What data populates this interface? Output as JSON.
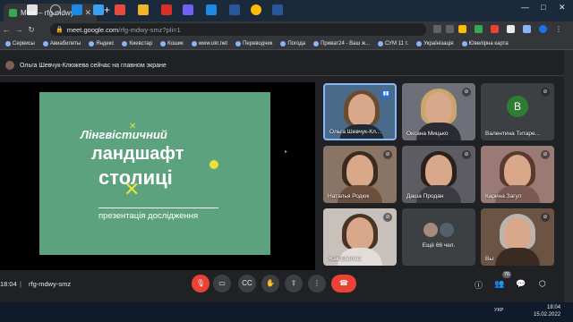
{
  "browser": {
    "tab_title": "Meet – rfg-mdwy-smz",
    "url_host": "meet.google.com",
    "url_path": "/rfg-mdwy-smz?pli=1",
    "bookmarks": [
      "Сервисы",
      "Авиабилеты",
      "Яндекс",
      "Киевстар",
      "Кошик",
      "www.ukr.net",
      "Переводчик",
      "Погода",
      "Приват24 - Ваш ж...",
      "СУМ 11 т.",
      "Українізація",
      "Ювелірна карта"
    ]
  },
  "meet": {
    "banner": "Ольга Шевчук-Клюжева сейчас на главном экране",
    "slide": {
      "line1": "Лінгвістичний",
      "line2": "ландшафт",
      "line3": "столиці",
      "subtitle": "презентація дослідження"
    },
    "tiles": [
      {
        "name": "Ольга Шевчук-Кл...",
        "speaking": true
      },
      {
        "name": "Оксана Мицько",
        "speaking": false
      },
      {
        "name": "Валентина Титаре...",
        "speaking": false,
        "initial": "В"
      },
      {
        "name": "Наталья Родюк",
        "speaking": false
      },
      {
        "name": "Даша Продан",
        "speaking": false
      },
      {
        "name": "Карина Загул",
        "speaking": false
      },
      {
        "name": "Жак Евеліна",
        "speaking": false
      },
      {
        "name": "",
        "more": "Ещё 66 чел."
      },
      {
        "name": "Вы",
        "speaking": false
      }
    ],
    "time": "18:04",
    "separator": "|",
    "meeting_code": "rfg-mdwy-smz",
    "participants_count": "76"
  },
  "taskbar": {
    "lang": "УКР",
    "time": "18:04",
    "date": "15.02.2022"
  },
  "colors": {
    "slide_bg": "#5ca27f",
    "slide_accent": "#e8e23b",
    "hangup": "#ea4335",
    "speaking": "#1a73e8"
  }
}
